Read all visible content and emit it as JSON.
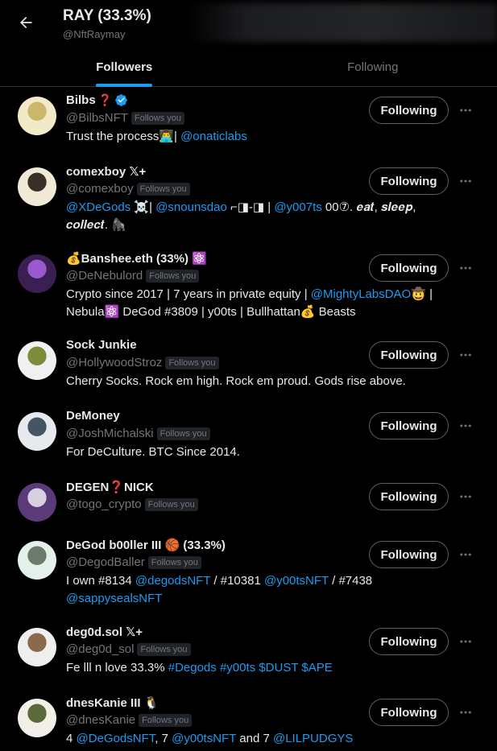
{
  "header": {
    "title": "RAY (33.3%)",
    "handle": "@NftRaymay"
  },
  "tabs": [
    {
      "label": "Followers",
      "active": true
    },
    {
      "label": "Following",
      "active": false
    }
  ],
  "follows_you_label": "Follows you",
  "button_label": "Following",
  "users": [
    {
      "name": "Bilbs",
      "name_suffix": "❓",
      "verified": true,
      "handle": "@BilbsNFT",
      "bio": [
        {
          "t": "Trust the process👨‍💻| "
        },
        {
          "t": "@onaticlabs",
          "link": true
        }
      ]
    },
    {
      "name": "comexboy 𝕏+",
      "handle": "@comexboy",
      "bio": [
        {
          "t": "@XDeGods",
          "link": true
        },
        {
          "t": " ☠️| "
        },
        {
          "t": "@snounsdao",
          "link": true
        },
        {
          "t": " ⌐◨-◨ | "
        },
        {
          "t": "@y007ts",
          "link": true
        },
        {
          "t": " 00⑦. 𝒆𝒂𝒕, 𝒔𝒍𝒆𝒆𝒑, 𝒄𝒐𝒍𝒍𝒆𝒄𝒕. 🦍"
        }
      ]
    },
    {
      "name": "💰Banshee.eth (33%) ⚛️",
      "handle": "@DeNebulord",
      "bio": [
        {
          "t": "Crypto since 2017 | 7 years in private equity | "
        },
        {
          "t": "@MightyLabsDAO",
          "link": true
        },
        {
          "t": "🤠 | Nebula⚛️ DeGod #3809 | y00ts | Bullhattan💰 Beasts"
        }
      ]
    },
    {
      "name": "Sock Junkie",
      "handle": "@HollywoodStroz",
      "bio": [
        {
          "t": "Cherry Socks. Rock em high. Rock em proud. Gods rise above."
        }
      ]
    },
    {
      "name": "DeMoney",
      "handle": "@JoshMichalski",
      "bio": [
        {
          "t": "For DeCulture. BTC Since 2014."
        }
      ]
    },
    {
      "name": "DEGEN❓NICK",
      "handle": "@togo_crypto",
      "bio": []
    },
    {
      "name": "DeGod b00ller III 🏀 (33.3%)",
      "handle": "@DegodBaller",
      "bio": [
        {
          "t": "I own #8134 "
        },
        {
          "t": "@degodsNFT",
          "link": true
        },
        {
          "t": " / #10381 "
        },
        {
          "t": "@y00tsNFT",
          "link": true
        },
        {
          "t": " / #7438 "
        },
        {
          "t": "@sappysealsNFT",
          "link": true
        }
      ]
    },
    {
      "name": "deg0d.sol 𝕏+",
      "handle": "@deg0d_sol",
      "bio": [
        {
          "t": "Fe lll n love 33.3% "
        },
        {
          "t": "#Degods",
          "link": true
        },
        {
          "t": " "
        },
        {
          "t": "#y00ts",
          "link": true
        },
        {
          "t": " "
        },
        {
          "t": "$DUST",
          "link": true
        },
        {
          "t": " "
        },
        {
          "t": "$APE",
          "link": true
        }
      ]
    },
    {
      "name": "dnesKanie III 🐧",
      "handle": "@dnesKanie",
      "bio": [
        {
          "t": "4 "
        },
        {
          "t": "@DeGodsNFT",
          "link": true
        },
        {
          "t": ", 7 "
        },
        {
          "t": "@y00tsNFT",
          "link": true
        },
        {
          "t": " and 7 "
        },
        {
          "t": "@LILPUDGYS",
          "link": true
        }
      ]
    }
  ],
  "colors": {
    "background": "#000000",
    "accent": "#1d9bf0",
    "muted": "#71767b",
    "text": "#e7e9ea",
    "border": "#2f3336"
  }
}
